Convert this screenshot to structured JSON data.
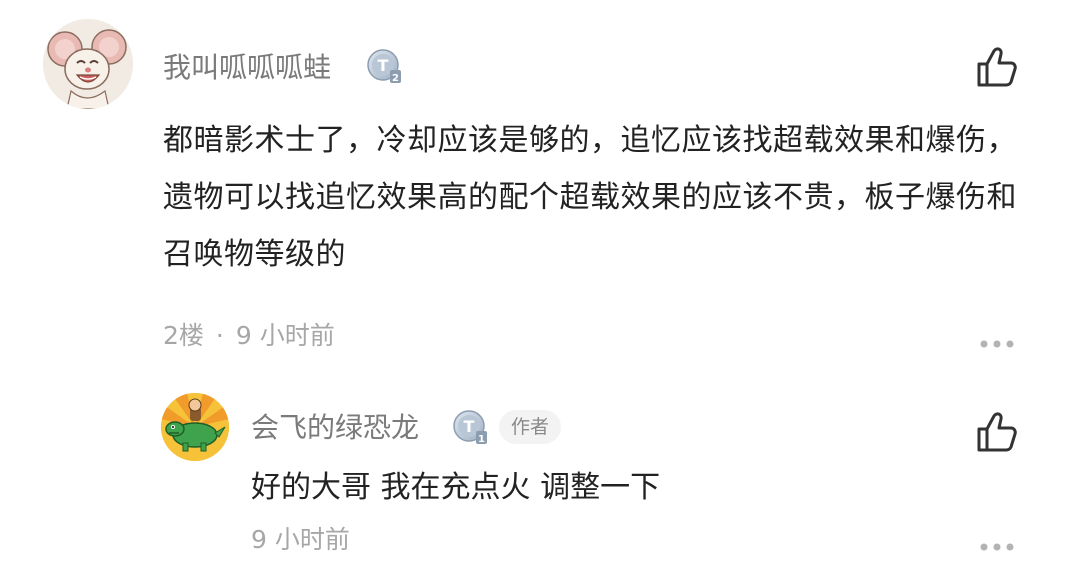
{
  "comment": {
    "avatar": "cartoon-mouse-avatar",
    "username": "我叫呱呱呱蛙",
    "level_badge": "T2",
    "level_icon": "tier-level-badge-icon",
    "text_lines": [
      "都暗影术士了，冷却应该是够的，追忆应该找超载效果和爆伤，",
      "遗物可以找追忆效果高的配个超载效果的应该不贵，板子爆伤和",
      "召唤物等级的"
    ],
    "floor": "2楼",
    "separator": "·",
    "time": "9 小时前",
    "like_icon": "thumbs-up-icon",
    "more_icon": "more-options-icon"
  },
  "reply": {
    "avatar": "cartoon-dinosaur-rider-avatar",
    "username": "会飞的绿恐龙",
    "level_badge": "T1",
    "level_icon": "tier-level-badge-icon",
    "author_badge": "作者",
    "text": "好的大哥 我在充点火 调整一下",
    "time": "9 小时前",
    "like_icon": "thumbs-up-icon",
    "more_icon": "more-options-icon"
  },
  "colors": {
    "text_primary": "#222222",
    "text_secondary": "#7a7a7a",
    "text_meta": "#a7a7a7",
    "badge_bg": "#f3f3f3"
  }
}
